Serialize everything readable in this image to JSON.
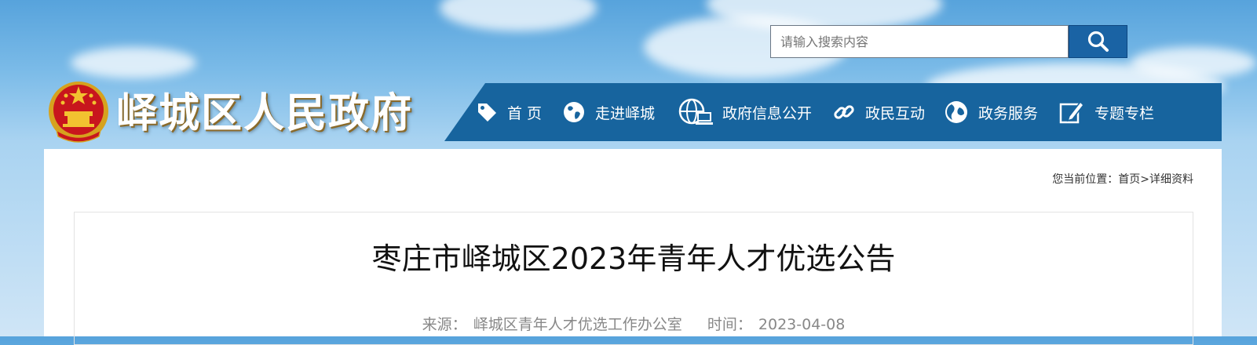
{
  "search": {
    "placeholder": "请输入搜索内容"
  },
  "site": {
    "title": "峄城区人民政府"
  },
  "nav": {
    "items": [
      {
        "label": "首 页",
        "icon": "tag-icon"
      },
      {
        "label": "走进峄城",
        "icon": "globe-icon"
      },
      {
        "label": "政府信息公开",
        "icon": "web-computer-icon"
      },
      {
        "label": "政民互动",
        "icon": "link-icon"
      },
      {
        "label": "政务服务",
        "icon": "globe-service-icon"
      },
      {
        "label": "专题专栏",
        "icon": "edit-icon"
      }
    ]
  },
  "breadcrumb": {
    "prefix": "您当前位置：",
    "home": "首页",
    "separator": ">",
    "current": "详细资料"
  },
  "article": {
    "title": "枣庄市峄城区2023年青年人才优选公告",
    "source_label": "来源：",
    "source": "峄城区青年人才优选工作办公室",
    "time_label": "时间：",
    "time": "2023-04-08"
  },
  "colors": {
    "nav_bg": "#17649e",
    "search_button": "#1a63a4",
    "panel_bg": "#ffffff"
  }
}
